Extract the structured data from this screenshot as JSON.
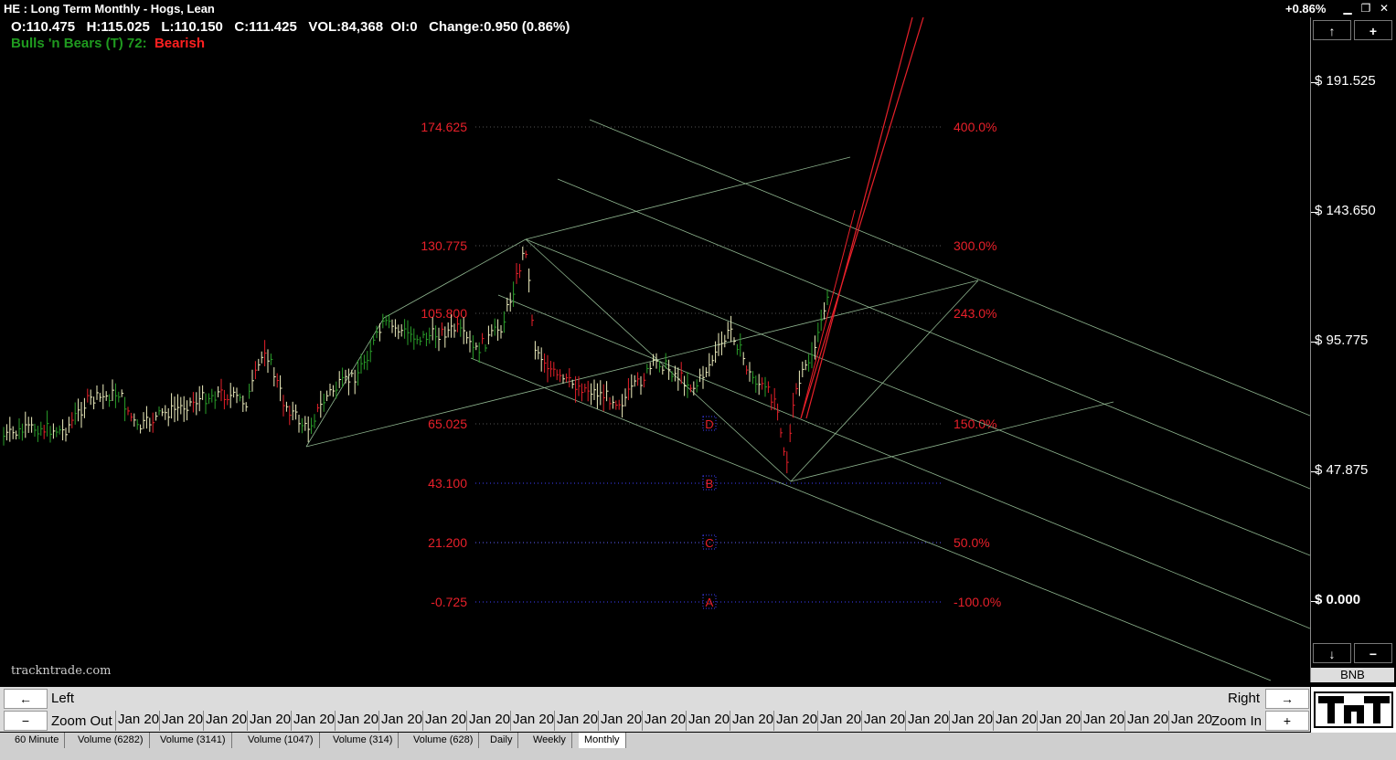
{
  "window": {
    "title": "HE : Long Term Monthly  -  Hogs, Lean",
    "change_pct": "+0.86%",
    "min_icon": "minimize-icon",
    "restore_icon": "restore-icon",
    "close_icon": "close-icon"
  },
  "quote": {
    "open": "O:110.475",
    "high": "H:115.025",
    "low": "L:110.150",
    "close": "C:111.425",
    "volume": "VOL:84,368",
    "oi": "OI:0",
    "change": "Change:0.950 (0.86%)"
  },
  "indicator": {
    "name": "Bulls 'n Bears (T) 72:",
    "state": "Bearish",
    "name_color": "#1f9a1f",
    "state_color": "#ff2020"
  },
  "price_axis": {
    "labels": [
      "$ 191.525",
      "$ 143.650",
      "$ 95.775",
      "$ 47.875",
      "$ 0.000"
    ],
    "up_icon": "arrow-up-icon",
    "plus_label": "+",
    "down_icon": "arrow-down-icon",
    "minus_label": "−",
    "bnb_label": "BNB"
  },
  "levels": [
    {
      "price": "174.625",
      "pct": "400.0%"
    },
    {
      "price": "130.775",
      "pct": "300.0%"
    },
    {
      "price": "105.800",
      "pct": "243.0%"
    },
    {
      "price": "65.025",
      "pct": "150.0%",
      "point": "D"
    },
    {
      "price": "43.100",
      "pct": "",
      "point": "B"
    },
    {
      "price": "21.200",
      "pct": "50.0%",
      "point": "C"
    },
    {
      "price": "-0.725",
      "pct": "-100.0%",
      "point": "A"
    }
  ],
  "watermark": "trackntrade.com",
  "navigation": {
    "left_label": "Left",
    "right_label": "Right",
    "zoom_out_label": "Zoom Out",
    "zoom_in_label": "Zoom In",
    "left_icon": "arrow-left-icon",
    "right_icon": "arrow-right-icon",
    "minus_label": "−",
    "plus_label": "+",
    "date_label": "Jan 20"
  },
  "tabs": [
    "60 Minute",
    "Volume (6282)",
    "Volume (3141)",
    "Volume (1047)",
    "Volume (314)",
    "Volume (628)",
    "Daily",
    "Weekly",
    "Monthly"
  ],
  "active_tab": "Monthly",
  "logo_text": "TnT",
  "colors": {
    "background": "#000000",
    "level_red": "#e8202a",
    "trend_green": "#7fc47f",
    "up_bar": "#f0f0c0",
    "down_bar": "#e8202a",
    "green_bar": "#2aa02a"
  }
}
